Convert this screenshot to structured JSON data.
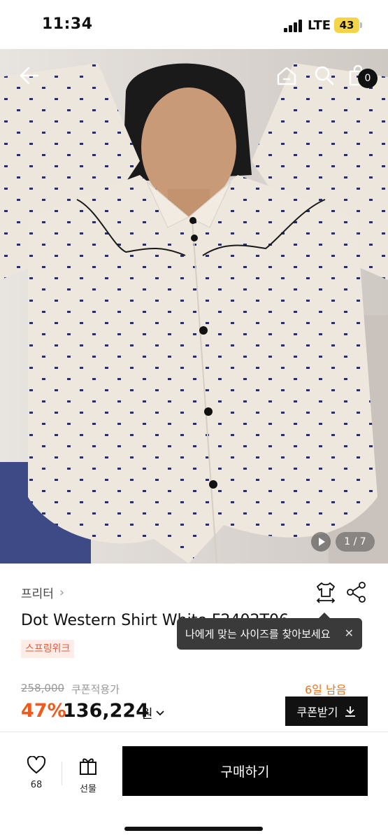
{
  "status_bar": {
    "time": "11:34",
    "network": "LTE",
    "battery": "43"
  },
  "gallery": {
    "counter": "1 / 7",
    "cart_count": "0"
  },
  "product": {
    "brand": "프리터",
    "title": "Dot Western Shirt White F2402T06",
    "promo_tag": "스프링위크",
    "size_tooltip": "나에게 맞는 사이즈를 찾아보세요"
  },
  "pricing": {
    "original_price": "258,000",
    "coupon_label": "쿠폰적용가",
    "days_left": "6일 남음",
    "discount": "47%",
    "price": "136,224",
    "currency": "원",
    "coupon_button": "쿠폰받기"
  },
  "bottom_bar": {
    "like_count": "68",
    "gift_label": "선물",
    "buy_label": "구매하기"
  },
  "colors": {
    "accent_orange": "#ef5a1e",
    "button_black": "#000000",
    "promo_bg": "#fdece7"
  }
}
